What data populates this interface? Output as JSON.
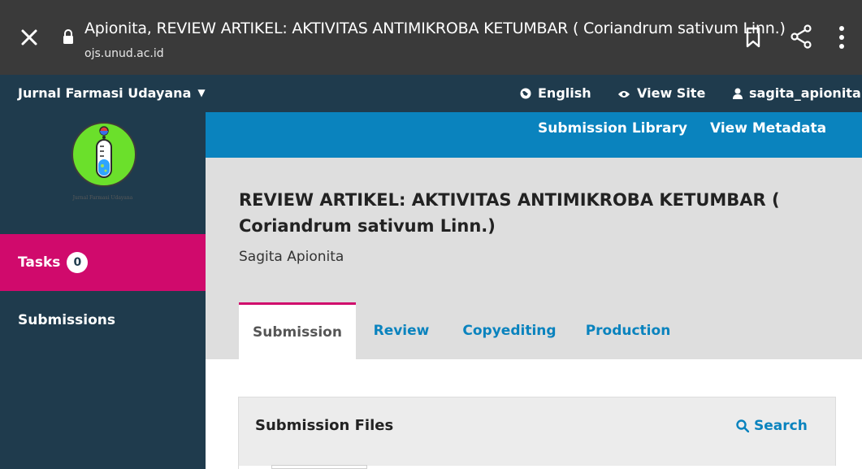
{
  "browser": {
    "title": "Apionita, REVIEW ARTIKEL: AKTIVITAS ANTIMIKROBA KETUMBAR ( Coriandrum sativum Linn.)",
    "url": "ojs.unud.ac.id"
  },
  "header": {
    "journal_name": "Jurnal Farmasi Udayana",
    "language": "English",
    "view_site": "View Site",
    "user": "sagita_apionita"
  },
  "sidebar": {
    "logo_caption": "Jurnal Farmasi Udayana",
    "tasks_label": "Tasks",
    "tasks_count": "0",
    "submissions_label": "Submissions"
  },
  "subnav": {
    "library": "Submission Library",
    "metadata": "View Metadata"
  },
  "submission": {
    "title": "REVIEW ARTIKEL: AKTIVITAS ANTIMIKROBA KETUMBAR ( Coriandrum sativum Linn.)",
    "author": "Sagita Apionita"
  },
  "tabs": [
    {
      "label": "Submission",
      "active": true
    },
    {
      "label": "Review",
      "active": false
    },
    {
      "label": "Copyediting",
      "active": false
    },
    {
      "label": "Production",
      "active": false
    }
  ],
  "files": {
    "title": "Submission Files",
    "search_label": "Search"
  },
  "colors": {
    "header_bg": "#1f3b4d",
    "accent_blue": "#0a83be",
    "accent_pink": "#d00a6c",
    "browser_bar": "#3a3a3a"
  },
  "icons": [
    "close-icon",
    "lock-icon",
    "bookmark-icon",
    "share-icon",
    "more-vert-icon",
    "globe-icon",
    "eye-icon",
    "user-icon",
    "search-icon",
    "chevron-down-icon"
  ]
}
